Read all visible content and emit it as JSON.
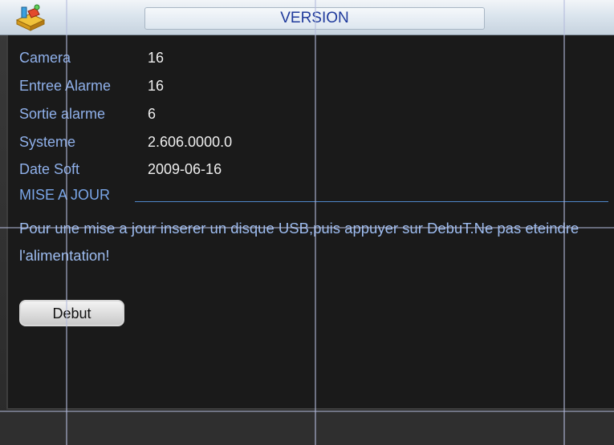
{
  "window": {
    "title": "VERSION"
  },
  "info": {
    "rows": [
      {
        "label": "Camera",
        "value": "16"
      },
      {
        "label": "Entree Alarme",
        "value": "16"
      },
      {
        "label": "Sortie alarme",
        "value": "6"
      },
      {
        "label": "Systeme",
        "value": "2.606.0000.0"
      },
      {
        "label": "Date Soft",
        "value": "2009-06-16"
      }
    ]
  },
  "update": {
    "section_title": "MISE A JOUR",
    "message": "Pour une mise a jour inserer un disque USB,puis appuyer sur DebuT.Ne pas eteindre l'alimentation!",
    "start_button_label": "Debut"
  },
  "icons": {
    "app": "toolbox-icon"
  },
  "colors": {
    "panel_background": "#1a1a1a",
    "label_blue": "#8fb0ea",
    "title_text": "#1f3a9c"
  }
}
